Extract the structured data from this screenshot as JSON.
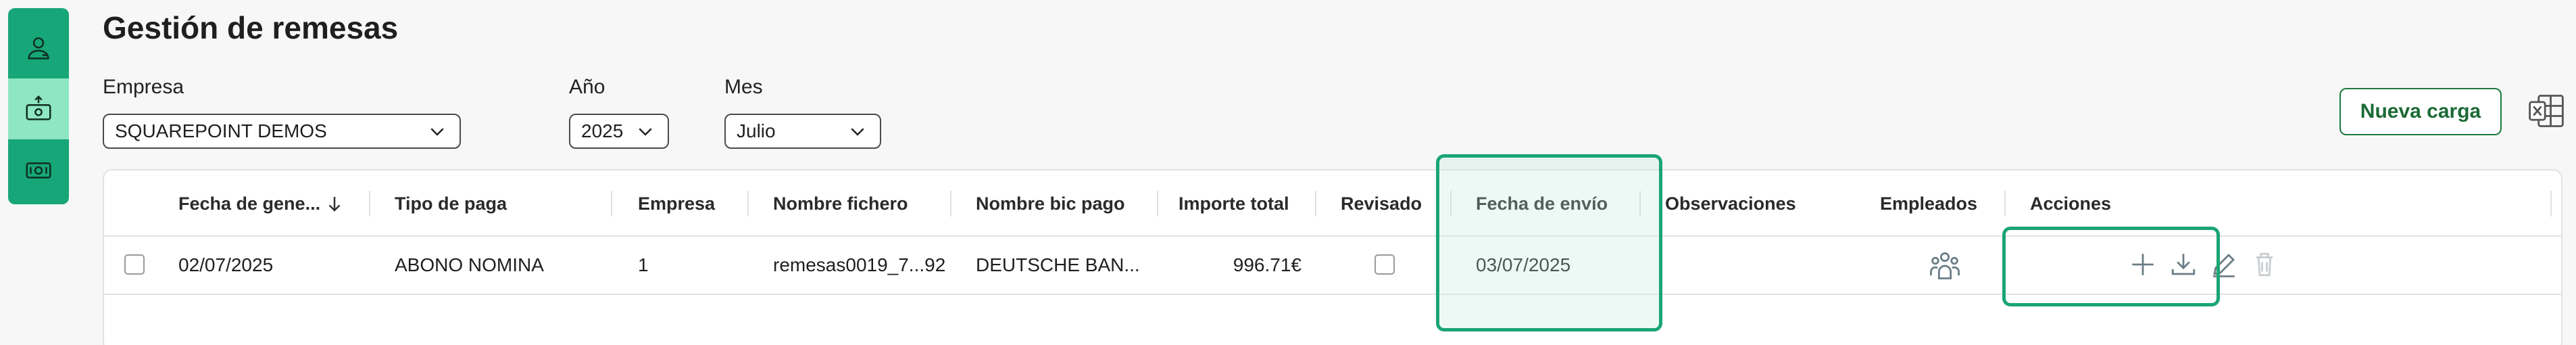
{
  "title": "Gestión de remesas",
  "filters": {
    "empresa": {
      "label": "Empresa",
      "value": "SQUAREPOINT DEMOS"
    },
    "anio": {
      "label": "Año",
      "value": "2025"
    },
    "mes": {
      "label": "Mes",
      "value": "Julio"
    }
  },
  "actions": {
    "nueva_carga": "Nueva carga"
  },
  "table": {
    "headers": {
      "fecha_generacion": "Fecha de gene...",
      "tipo_paga": "Tipo de paga",
      "empresa": "Empresa",
      "nombre_fichero": "Nombre fichero",
      "nombre_bic": "Nombre bic pago",
      "importe": "Importe total",
      "revisado": "Revisado",
      "fecha_envio": "Fecha de envío",
      "observaciones": "Observaciones",
      "empleados": "Empleados",
      "acciones": "Acciones"
    },
    "rows": [
      {
        "fecha_generacion": "02/07/2025",
        "tipo_paga": "ABONO NOMINA",
        "empresa": "1",
        "nombre_fichero": "remesas0019_7...92",
        "nombre_bic": "DEUTSCHE BAN...",
        "importe": "996.71€",
        "fecha_envio": "03/07/2025",
        "observaciones": ""
      }
    ]
  },
  "colors": {
    "sidebar": "#17a678",
    "sidebar_active": "#8fe6c2",
    "highlight": "#1aa574",
    "brand_text": "#1b6a35"
  },
  "icons": {
    "sidebar": [
      "user-icon",
      "upload-money-icon",
      "money-icon"
    ],
    "row_actions": [
      "plus-icon",
      "download-icon",
      "edit-icon",
      "trash-icon"
    ],
    "employees": "group-icon",
    "export": "excel-icon",
    "sort": "arrow-down-icon"
  }
}
